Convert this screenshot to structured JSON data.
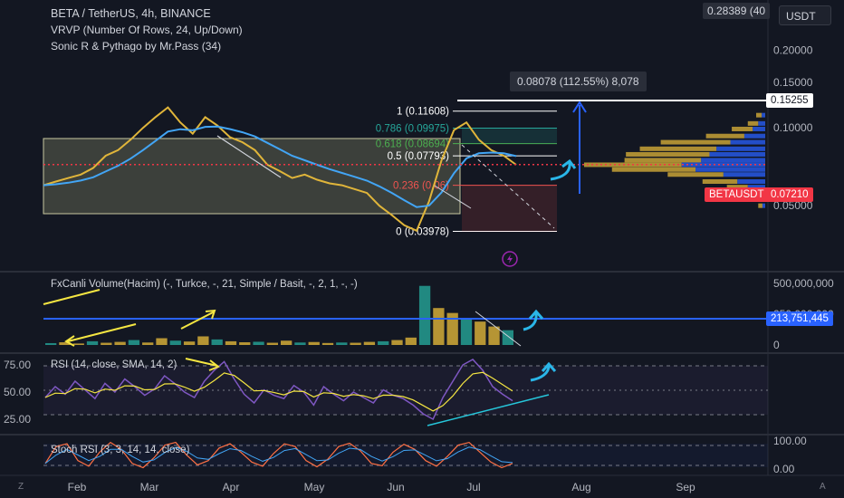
{
  "header": {
    "title": "BETA / TetherUS, 4h, BINANCE",
    "indicator_1": "VRVP (Number Of Rows, 24, Up/Down)",
    "indicator_2": "Sonic R & Pythago by Mr.Pass (34)"
  },
  "currency_button": "USDT",
  "top_price_tag": "0.28389 (40",
  "measure_callout": "0.08078 (112.55%) 8,078",
  "price_labels": {
    "target": "0.15255",
    "symbol": "BETAUSDT",
    "last": "0.07210",
    "volume_line": "213,751,445"
  },
  "colors": {
    "background": "#131722",
    "fib_white": "#ffffff",
    "fib_teal": "#26a69a",
    "fib_green": "#4caf50",
    "price_red": "#f23645",
    "vol_up": "#2962ff",
    "vol_down": "#e0b53a",
    "annotation_yellow": "#f5e642",
    "annotation_cyan": "#2ab6e8"
  },
  "chart_data": [
    {
      "type": "line",
      "title": "BETA / TetherUS, 4h, BINANCE",
      "x_ticks": [
        "Feb",
        "Mar",
        "Apr",
        "May",
        "Jun",
        "Jul",
        "Aug",
        "Sep"
      ],
      "y_ticks": [
        "0.20000",
        "0.15000",
        "0.10000",
        "0.05000"
      ],
      "y_scale": "log",
      "ylim": [
        0.034,
        0.3
      ],
      "series": [
        {
          "values": [
            0.06,
            0.062,
            0.064,
            0.066,
            0.07,
            0.078,
            0.082,
            0.09,
            0.1,
            0.11,
            0.12,
            0.105,
            0.095,
            0.11,
            0.102,
            0.092,
            0.088,
            0.082,
            0.072,
            0.068,
            0.064,
            0.066,
            0.063,
            0.061,
            0.06,
            0.058,
            0.056,
            0.05,
            0.046,
            0.042,
            0.04,
            0.052,
            0.075,
            0.098,
            0.105,
            0.09,
            0.082,
            0.078,
            0.072
          ]
        }
      ],
      "fibonacci": [
        {
          "level": "1",
          "price": "0.11608"
        },
        {
          "level": "0.786",
          "price": "0.09975"
        },
        {
          "level": "0.618",
          "price": "0.08694"
        },
        {
          "level": "0.5",
          "price": "0.07793"
        },
        {
          "level": "0.236",
          "price": "0.06"
        },
        {
          "level": "0",
          "price": "0.03978"
        }
      ],
      "volume_profile": {
        "prices": [
          0.112,
          0.104,
          0.099,
          0.093,
          0.088,
          0.083,
          0.079,
          0.075,
          0.072,
          0.069,
          0.066,
          0.062,
          0.059,
          0.056,
          0.053,
          0.05
        ],
        "up": [
          5,
          10,
          18,
          30,
          50,
          70,
          80,
          92,
          120,
          100,
          60,
          40,
          25,
          15,
          8,
          4
        ],
        "down": [
          8,
          15,
          30,
          55,
          100,
          110,
          120,
          110,
          140,
          120,
          80,
          50,
          30,
          20,
          12,
          6
        ]
      }
    },
    {
      "type": "bar",
      "title": "FxCanli Volume(Hacim) (-, Turkce, -, 21, Simple / Basit, -, 2, 1, -, -)",
      "y_ticks": [
        "500,000,000",
        "250,000,000",
        "0"
      ],
      "ylim": [
        0,
        500000000
      ],
      "values": [
        15000000,
        22000000,
        12000000,
        30000000,
        18000000,
        25000000,
        40000000,
        20000000,
        55000000,
        35000000,
        28000000,
        70000000,
        45000000,
        30000000,
        22000000,
        26000000,
        18000000,
        35000000,
        20000000,
        24000000,
        16000000,
        20000000,
        18000000,
        25000000,
        30000000,
        40000000,
        60000000,
        480000000,
        300000000,
        260000000,
        220000000,
        190000000,
        150000000,
        120000000
      ],
      "reference_line": 213751445
    },
    {
      "type": "line",
      "title": "RSI (14, close, SMA, 14, 2)",
      "y_ticks": [
        "75.00",
        "50.00",
        "25.00"
      ],
      "ylim": [
        15,
        85
      ],
      "series": [
        {
          "values": [
            45,
            55,
            48,
            60,
            52,
            44,
            58,
            50,
            62,
            55,
            47,
            53,
            65,
            58,
            50,
            45,
            60,
            70,
            78,
            62,
            48,
            40,
            52,
            47,
            44,
            56,
            50,
            38,
            55,
            48,
            42,
            50,
            45,
            40,
            52,
            47,
            44,
            38,
            30,
            25,
            45,
            60,
            75,
            80,
            70,
            55,
            48,
            42
          ]
        }
      ]
    },
    {
      "type": "line",
      "title": "Stoch RSI (3, 3, 14, 14, close)",
      "y_ticks": [
        "100.00",
        "0.00"
      ],
      "ylim": [
        0,
        100
      ],
      "series": [
        {
          "values": [
            20,
            80,
            90,
            30,
            10,
            60,
            95,
            70,
            20,
            5,
            40,
            85,
            95,
            50,
            15,
            30,
            75,
            90,
            60,
            25,
            10,
            55,
            90,
            80,
            30,
            8,
            35,
            80,
            92,
            65,
            20,
            12,
            60,
            88,
            70,
            30,
            10,
            45,
            85,
            95,
            60,
            25,
            5,
            20
          ]
        }
      ]
    }
  ]
}
